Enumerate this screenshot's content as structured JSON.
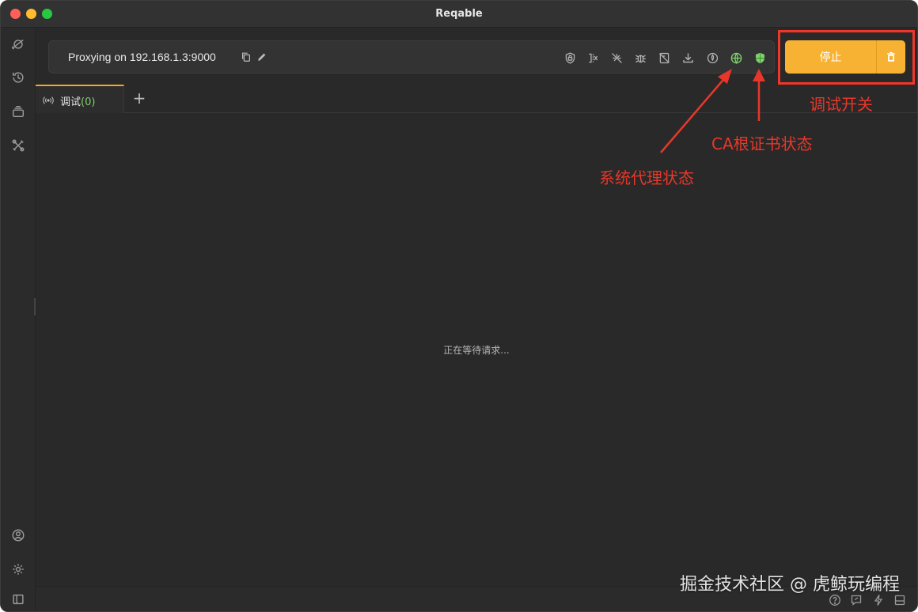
{
  "window": {
    "title": "Reqable"
  },
  "sidebar": {
    "items": [
      {
        "icon": "planet-icon"
      },
      {
        "icon": "history-icon"
      },
      {
        "icon": "stack-icon"
      },
      {
        "icon": "tools-icon"
      }
    ],
    "bottom_items": [
      {
        "icon": "user-icon"
      },
      {
        "icon": "settings-icon"
      },
      {
        "icon": "panel-icon"
      }
    ]
  },
  "proxy": {
    "status_text": "Proxying on 192.168.1.3:9000"
  },
  "toolbar": {
    "stop_label": "停止",
    "icons": [
      "shield-lock-icon",
      "rewrite-icon",
      "no-breakpoint-icon",
      "bug-icon",
      "disabled-script-icon",
      "download-icon",
      "timer-icon",
      "system-proxy-globe-icon",
      "ca-shield-icon"
    ],
    "active_color": "#7ed36b",
    "accent_color": "#f8b233"
  },
  "tabs": [
    {
      "label": "调试",
      "count": "(0)"
    }
  ],
  "main": {
    "empty_message": "正在等待请求..."
  },
  "annotations": {
    "debug_switch": "调试开关",
    "ca_status": "CA根证书状态",
    "system_proxy_status": "系统代理状态",
    "color": "#e8372a"
  },
  "watermark": "掘金技术社区 @ 虎鲸玩编程"
}
